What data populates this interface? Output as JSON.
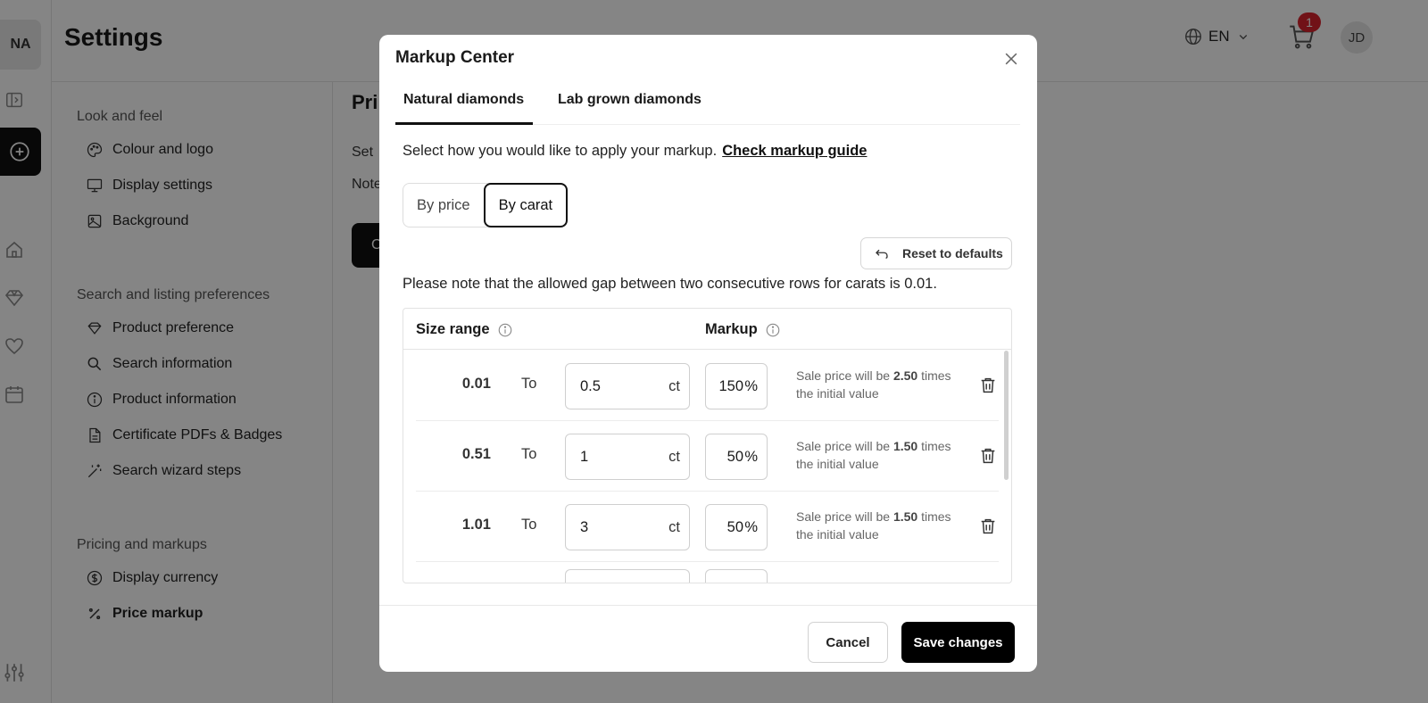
{
  "workspace": {
    "initials": "NA"
  },
  "header": {
    "title": "Settings",
    "language": "EN",
    "cart_count": "1",
    "user_initials": "JD"
  },
  "sidebar": {
    "sections": [
      {
        "title": "Look and feel",
        "items": [
          {
            "label": "Colour and logo",
            "icon": "palette-icon"
          },
          {
            "label": "Display settings",
            "icon": "monitor-icon"
          },
          {
            "label": "Background",
            "icon": "image-icon"
          }
        ]
      },
      {
        "title": "Search and listing preferences",
        "items": [
          {
            "label": "Product preference",
            "icon": "diamond-icon"
          },
          {
            "label": "Search information",
            "icon": "search-icon"
          },
          {
            "label": "Product information",
            "icon": "info-icon"
          },
          {
            "label": "Certificate PDFs & Badges",
            "icon": "document-icon"
          },
          {
            "label": "Search wizard steps",
            "icon": "wand-icon"
          }
        ]
      },
      {
        "title": "Pricing and markups",
        "items": [
          {
            "label": "Display currency",
            "icon": "dollar-icon"
          },
          {
            "label": "Price markup",
            "icon": "percent-icon",
            "active": true
          }
        ]
      }
    ]
  },
  "main": {
    "heading": "Pri",
    "line1": "Set",
    "line2": "Note",
    "button_label": "C"
  },
  "modal": {
    "title": "Markup Center",
    "tabs": [
      {
        "label": "Natural diamonds",
        "active": true
      },
      {
        "label": "Lab grown diamonds",
        "active": false
      }
    ],
    "intro": "Select how you would like to apply your markup.",
    "guide_link": "Check markup guide",
    "mode_options": [
      {
        "label": "By price",
        "selected": false
      },
      {
        "label": "By carat",
        "selected": true
      }
    ],
    "reset_label": "Reset to defaults",
    "note": "Please note that the allowed gap between two consecutive rows for carats is 0.01.",
    "table": {
      "col_size": "Size range",
      "col_markup": "Markup",
      "to_label": "To",
      "ct_unit": "ct",
      "pct_unit": "%",
      "desc_prefix": "Sale price will be",
      "desc_suffix": "times the initial value",
      "rows": [
        {
          "from": "0.01",
          "to": "0.5",
          "markup": "150",
          "multiplier": "2.50"
        },
        {
          "from": "0.51",
          "to": "1",
          "markup": "50",
          "multiplier": "1.50"
        },
        {
          "from": "1.01",
          "to": "3",
          "markup": "50",
          "multiplier": "1.50"
        }
      ]
    },
    "cancel_label": "Cancel",
    "save_label": "Save changes"
  }
}
